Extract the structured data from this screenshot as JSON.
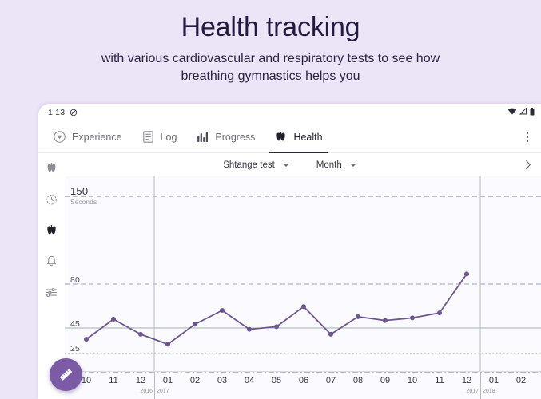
{
  "promo": {
    "title": "Health tracking",
    "subtitle_line1": "with various cardiovascular and respiratory tests to see how",
    "subtitle_line2": "breathing gymnastics helps you"
  },
  "statusbar": {
    "time": "1:13",
    "mute_icon": "mute-icon",
    "wifi_icon": "wifi-icon",
    "signal_icon": "signal-icon",
    "battery_icon": "battery-icon"
  },
  "topnav": {
    "tabs": [
      {
        "label": "Experience",
        "icon": "compass-icon",
        "active": false
      },
      {
        "label": "Log",
        "icon": "list-icon",
        "active": false
      },
      {
        "label": "Progress",
        "icon": "bar-chart-icon",
        "active": false
      },
      {
        "label": "Health",
        "icon": "lungs-icon",
        "active": true
      }
    ],
    "overflow_icon": "kebab-menu-icon"
  },
  "filterbar": {
    "prev_icon": "chevron-left-icon",
    "next_icon": "chevron-right-icon",
    "test_select": {
      "value": "Shtange test",
      "caret": "chevron-down-icon"
    },
    "period_select": {
      "value": "Month",
      "caret": "chevron-down-icon"
    }
  },
  "rail": {
    "items": [
      {
        "icon": "lungs-icon"
      },
      {
        "icon": "stopwatch-icon"
      },
      {
        "icon": "heart-lungs-icon"
      },
      {
        "icon": "bell-icon"
      },
      {
        "icon": "sliders-icon"
      }
    ]
  },
  "fab": {
    "icon": "ruler-icon",
    "color": "#7b5aa6"
  },
  "colors": {
    "line": "#6b5690",
    "accent": "#7b5aa6",
    "grid_80": "#8fa7d6",
    "grid_45": "#9fb5ae",
    "grid_25": "#cfc9a8",
    "grid_10": "#7d7a92",
    "grid_150": "#7d7a92",
    "plot_bg": "#fafaff",
    "promo_bg": "#ece5f7"
  },
  "chart_data": {
    "type": "line",
    "title": "Shtange test",
    "xlabel": "",
    "ylabel": "Seconds",
    "ylim": [
      0,
      160
    ],
    "grid": true,
    "legend": "none",
    "y_ticks": [
      {
        "value": 150,
        "label": "150",
        "unit": "Seconds",
        "style": "dashed"
      },
      {
        "value": 80,
        "label": "80",
        "style": "dashed"
      },
      {
        "value": 45,
        "label": "45",
        "style": "solid"
      },
      {
        "value": 25,
        "label": "25",
        "style": "dotted"
      },
      {
        "value": 10,
        "label": "10",
        "style": "dashdot"
      }
    ],
    "x_categories": [
      "10",
      "11",
      "12",
      "01",
      "02",
      "03",
      "04",
      "05",
      "06",
      "07",
      "08",
      "09",
      "10",
      "11",
      "12",
      "01",
      "02"
    ],
    "year_markers": [
      {
        "after_index": 2,
        "left_label": "2016",
        "right_label": "2017"
      },
      {
        "after_index": 14,
        "left_label": "2017",
        "right_label": "2018"
      }
    ],
    "series": [
      {
        "name": "Shtange test",
        "color": "#6b5690",
        "values": [
          36,
          52,
          40,
          32,
          48,
          59,
          44,
          46,
          62,
          40,
          54,
          51,
          53,
          57,
          88
        ]
      }
    ],
    "points": [
      {
        "x": "10",
        "year": "2016",
        "value": 36
      },
      {
        "x": "11",
        "year": "2016",
        "value": 52
      },
      {
        "x": "12",
        "year": "2016",
        "value": 40
      },
      {
        "x": "01",
        "year": "2017",
        "value": 32
      },
      {
        "x": "02",
        "year": "2017",
        "value": 48
      },
      {
        "x": "03",
        "year": "2017",
        "value": 59
      },
      {
        "x": "04",
        "year": "2017",
        "value": 44
      },
      {
        "x": "05",
        "year": "2017",
        "value": 46
      },
      {
        "x": "06",
        "year": "2017",
        "value": 62
      },
      {
        "x": "07",
        "year": "2017",
        "value": 40
      },
      {
        "x": "08",
        "year": "2017",
        "value": 54
      },
      {
        "x": "09",
        "year": "2017",
        "value": 51
      },
      {
        "x": "10",
        "year": "2017",
        "value": 53
      },
      {
        "x": "11",
        "year": "2017",
        "value": 57
      },
      {
        "x": "12",
        "year": "2017",
        "value": 88
      }
    ]
  }
}
